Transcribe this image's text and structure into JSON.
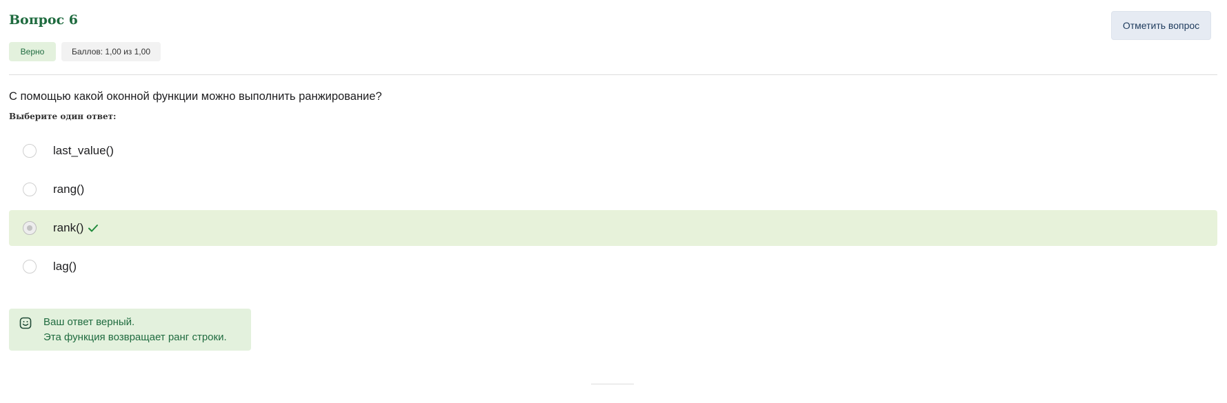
{
  "question": {
    "title": "Вопрос 6",
    "flag_label": "Отметить вопрос",
    "status": "Верно",
    "grade": "Баллов: 1,00 из 1,00",
    "text": "С помощью какой оконной функции можно выполнить ранжирование?",
    "prompt": "Выберите один ответ:"
  },
  "answers": [
    {
      "label": "last_value()",
      "selected": false,
      "correct": false
    },
    {
      "label": "rang()",
      "selected": false,
      "correct": false
    },
    {
      "label": "rank()",
      "selected": true,
      "correct": true
    },
    {
      "label": "lag()",
      "selected": false,
      "correct": false
    }
  ],
  "feedback": {
    "line1": "Ваш ответ верный.",
    "line2": "Эта функция возвращает ранг строки.",
    "icon": "smile-icon"
  },
  "colors": {
    "accent_green": "#1f6b3f",
    "correct_bg": "#e7f2da",
    "flag_bg": "#e6ebf3"
  }
}
